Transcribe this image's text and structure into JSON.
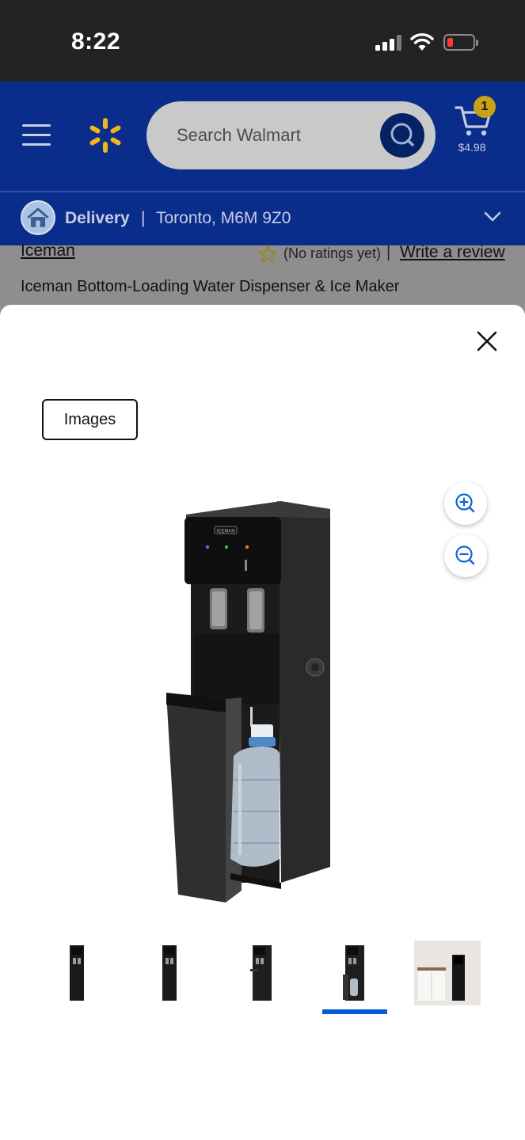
{
  "status_bar": {
    "time": "8:22"
  },
  "header": {
    "search_placeholder": "Search Walmart",
    "cart_count": "1",
    "cart_total": "$4.98",
    "brand_color": "#0a2d8c",
    "spark_color": "#f2b51b"
  },
  "delivery": {
    "label": "Delivery",
    "separator": "|",
    "location": "Toronto, M6M 9Z0"
  },
  "product": {
    "brand": "Iceman",
    "ratings_text": "(No ratings yet)",
    "ratings_separator": "|",
    "write_review": "Write a review",
    "title": "Iceman Bottom-Loading Water Dispenser & Ice Maker"
  },
  "gallery": {
    "tab_label": "Images",
    "main_image_logo": "ICEMAN",
    "selected_thumbnail": 4,
    "thumbnails": [
      "dispenser-front",
      "dispenser-angle",
      "dispenser-side",
      "dispenser-open-door",
      "dispenser-in-kitchen"
    ]
  }
}
